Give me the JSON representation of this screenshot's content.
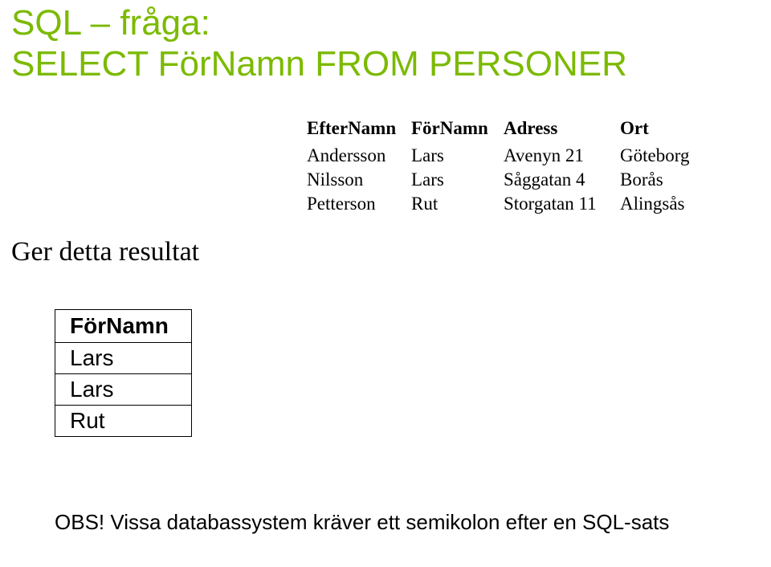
{
  "title": {
    "line1": "SQL – fråga:",
    "line2": "SELECT FörNamn FROM PERSONER"
  },
  "result_label": "Ger detta resultat",
  "data_table": {
    "headers": [
      "EfterNamn",
      "FörNamn",
      "Adress",
      "Ort"
    ],
    "rows": [
      [
        "Andersson",
        "Lars",
        "Avenyn 21",
        "Göteborg"
      ],
      [
        "Nilsson",
        "Lars",
        "Såggatan 4",
        "Borås"
      ],
      [
        "Petterson",
        "Rut",
        "Storgatan 11",
        "Alingsås"
      ]
    ]
  },
  "result_table": {
    "header": "FörNamn",
    "rows": [
      "Lars",
      "Lars",
      "Rut"
    ]
  },
  "note": "OBS! Vissa databassystem kräver ett semikolon efter en SQL-sats"
}
